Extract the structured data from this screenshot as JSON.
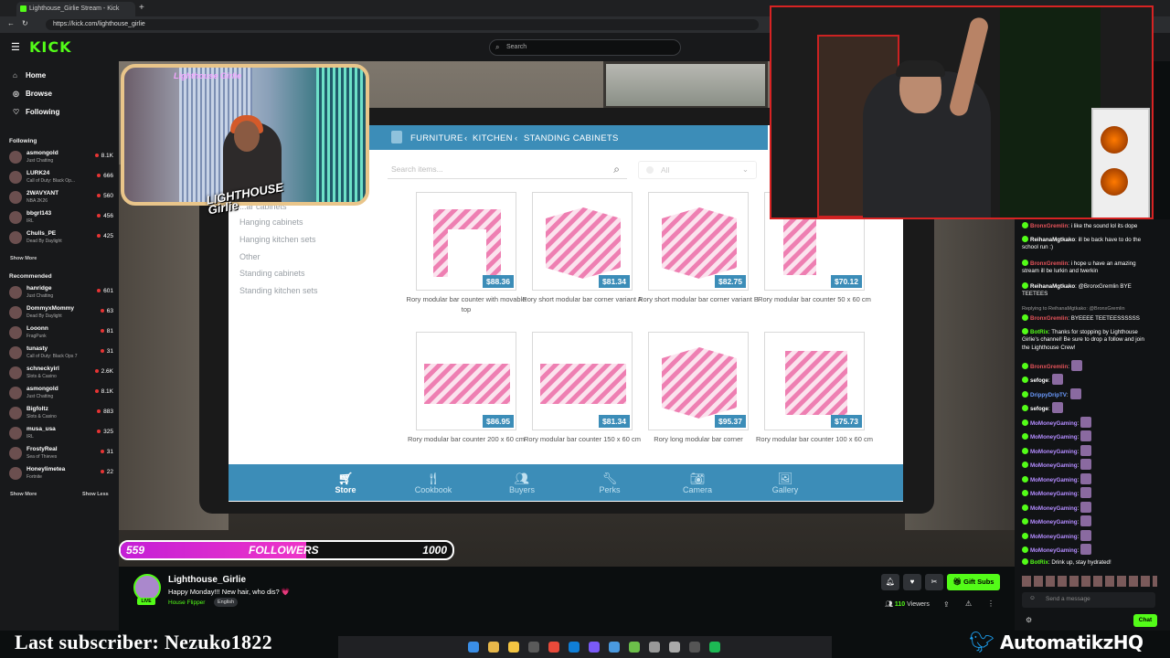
{
  "browser": {
    "tab_title": "Lighthouse_Girlie Stream - Kick",
    "url": "https://kick.com/lighthouse_girlie"
  },
  "header": {
    "logo": "KICK",
    "search_placeholder": "Search"
  },
  "sidebar": {
    "nav": [
      {
        "label": "Home",
        "icon": "home-icon"
      },
      {
        "label": "Browse",
        "icon": "compass-icon"
      },
      {
        "label": "Following",
        "icon": "heart-icon"
      }
    ],
    "following_title": "Following",
    "following": [
      {
        "name": "asmongold",
        "game": "Just Chatting",
        "viewers": "8.1K"
      },
      {
        "name": "LURK24",
        "game": "Call of Duty: Black Op...",
        "viewers": "666"
      },
      {
        "name": "2WAVYANT",
        "game": "NBA 2K26",
        "viewers": "560"
      },
      {
        "name": "bbgrl143",
        "game": "IRL",
        "viewers": "456"
      },
      {
        "name": "Chulls_PE",
        "game": "Dead By Daylight",
        "viewers": "425"
      }
    ],
    "show_more": "Show More",
    "recommended_title": "Recommended",
    "recommended": [
      {
        "name": "hanridge",
        "game": "Just Chatting",
        "viewers": "601"
      },
      {
        "name": "DommyxMommy",
        "game": "Dead By Daylight",
        "viewers": "63"
      },
      {
        "name": "Looonn",
        "game": "FragPunk",
        "viewers": "81"
      },
      {
        "name": "tunasty",
        "game": "Call of Duty: Black Ops 7",
        "viewers": "31"
      },
      {
        "name": "schneckyirl",
        "game": "Slots & Casino",
        "viewers": "2.6K"
      },
      {
        "name": "asmongold",
        "game": "Just Chatting",
        "viewers": "8.1K"
      },
      {
        "name": "Bigfoltz",
        "game": "Slots & Casino",
        "viewers": "883"
      },
      {
        "name": "musa_usa",
        "game": "IRL",
        "viewers": "325"
      },
      {
        "name": "FrostyReal",
        "game": "Sea of Thieves",
        "viewers": "31"
      },
      {
        "name": "Honeylimetea",
        "game": "Fortnite",
        "viewers": "22"
      }
    ],
    "show_more2": "Show More",
    "show_less": "Show Less"
  },
  "game": {
    "breadcrumb": [
      "FURNITURE",
      "KITCHEN",
      "STANDING CABINETS"
    ],
    "search_placeholder": "Search items...",
    "filter": "All",
    "categories": [
      "...ar cabinets",
      "Hanging cabinets",
      "Hanging kitchen sets",
      "Other",
      "Standing cabinets",
      "Standing kitchen sets"
    ],
    "items": [
      {
        "name": "Rory modular bar counter with movable top",
        "price": "$88.36"
      },
      {
        "name": "Rory short modular bar corner variant A",
        "price": "$81.34"
      },
      {
        "name": "Rory short modular bar corner variant B",
        "price": "$82.75"
      },
      {
        "name": "Rory modular bar counter 50 x 60 cm",
        "price": "$70.12"
      },
      {
        "name": "Rory modular bar counter 200 x 60 cm",
        "price": "$86.95"
      },
      {
        "name": "Rory modular bar counter 150 x 60 cm",
        "price": "$81.34"
      },
      {
        "name": "Rory long modular bar corner",
        "price": "$95.37"
      },
      {
        "name": "Rory modular bar counter 100 x 60 cm",
        "price": "$75.73"
      }
    ],
    "tabs": [
      {
        "label": "Store",
        "icon": "cart-icon"
      },
      {
        "label": "Cookbook",
        "icon": "utensils-icon"
      },
      {
        "label": "Buyers",
        "icon": "people-icon"
      },
      {
        "label": "Perks",
        "icon": "wrench-icon"
      },
      {
        "label": "Camera",
        "icon": "camera-icon"
      },
      {
        "label": "Gallery",
        "icon": "image-icon"
      }
    ]
  },
  "overlay": {
    "cam_title": "Lighthouse Girlie",
    "cam_logo": "LIGHTHOUSE Girlie",
    "followers_current": "559",
    "followers_label": "FOLLOWERS",
    "followers_goal": "1000",
    "followers_progress": 0.559,
    "last_subscriber": "Last subscriber: Nezuko1822",
    "handle": "AutomatikzHQ"
  },
  "stream": {
    "name": "Lighthouse_Girlie",
    "title": "Happy Monday!!! New hair, who dis? 💗",
    "game": "House Flipper",
    "language": "English",
    "live": "LIVE",
    "gift_subs": "Gift Subs",
    "viewers_count": "110",
    "viewers_label": "Viewers"
  },
  "chat": {
    "messages": [
      {
        "user": "BronxGremlin",
        "text": ": i like the sound lol its dope",
        "color": "#e5535a"
      },
      {
        "user": "ReihanaMgtkako",
        "text": ": ill be back have to do the school run :)",
        "color": "#ffffff"
      },
      {
        "user": "BronxGremlin",
        "text": ": i hope u have an amazing stream ill be lurkin and twerkin",
        "color": "#e5535a"
      },
      {
        "user": "ReihanaMgtkako",
        "text": ": @BronxGremlin BYE TEETEES",
        "color": "#ffffff"
      },
      {
        "user": "BronxGremlin",
        "text": ": BYEEEE TEETEESSSSSS",
        "color": "#e5535a"
      },
      {
        "user": "BotRix",
        "text": ": Thanks for stopping by Lighthouse Girlie's channel! Be sure to drop a follow and join the Lighthouse Crew!",
        "color": "#53fc18"
      },
      {
        "user": "BronxGremlin",
        "text": ":",
        "color": "#e5535a"
      },
      {
        "user": "sefoge",
        "text": ":",
        "color": "#ffffff"
      },
      {
        "user": "DrippyDripTV",
        "text": ":",
        "color": "#6b9bff"
      },
      {
        "user": "sefoge",
        "text": ":",
        "color": "#ffffff"
      },
      {
        "user": "MoMoneyGaming",
        "text": ":",
        "color": "#b38cff"
      },
      {
        "user": "MoMoneyGaming",
        "text": ":",
        "color": "#b38cff"
      },
      {
        "user": "MoMoneyGaming",
        "text": ":",
        "color": "#b38cff"
      },
      {
        "user": "MoMoneyGaming",
        "text": ":",
        "color": "#b38cff"
      },
      {
        "user": "MoMoneyGaming",
        "text": ":",
        "color": "#b38cff"
      },
      {
        "user": "MoMoneyGaming",
        "text": ":",
        "color": "#b38cff"
      },
      {
        "user": "MoMoneyGaming",
        "text": ":",
        "color": "#b38cff"
      },
      {
        "user": "MoMoneyGaming",
        "text": ":",
        "color": "#b38cff"
      },
      {
        "user": "MoMoneyGaming",
        "text": ":",
        "color": "#b38cff"
      },
      {
        "user": "MoMoneyGaming",
        "text": ":",
        "color": "#b38cff"
      },
      {
        "user": "BotRix",
        "text": ": Drink up, stay hydrated!",
        "color": "#53fc18"
      }
    ],
    "reply_note": "Replying to ReihanaMgtkako: @BronxGremlin",
    "send_placeholder": "Send a message",
    "chat_button": "Chat"
  },
  "colors": {
    "kick_green": "#53fc18",
    "game_blue": "#3c8db8",
    "follow_pink": "#e535c8"
  }
}
